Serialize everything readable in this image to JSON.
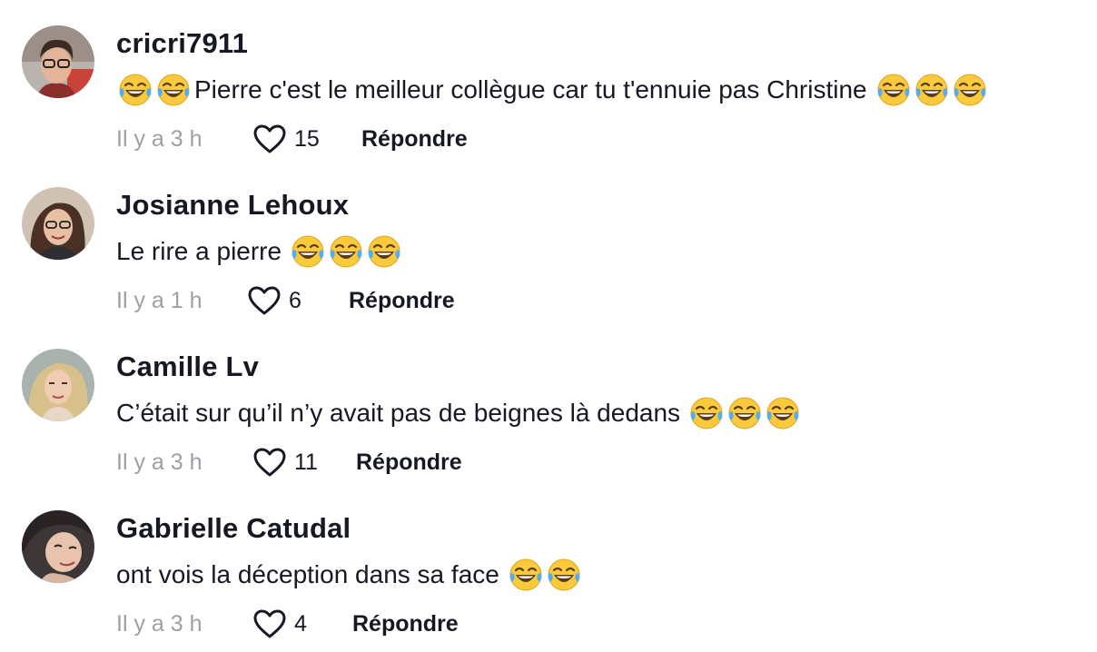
{
  "comments": [
    {
      "username": "cricri7911",
      "text": "Pierre c'est le meilleur collègue car tu t'ennuie pas Christine",
      "time": "Il y a 3 h",
      "likes": "15",
      "reply_label": "Répondre",
      "avatar_icon": "avatar-photo"
    },
    {
      "username": "Josianne Lehoux",
      "text": "Le rire a pierre",
      "time": "Il y a 1 h",
      "likes": "6",
      "reply_label": "Répondre",
      "avatar_icon": "avatar-photo"
    },
    {
      "username": "Camille Lv",
      "text": "C’était sur qu’il n’y avait pas de beignes là dedans",
      "time": "Il y a 3 h",
      "likes": "11",
      "reply_label": "Répondre",
      "avatar_icon": "avatar-photo"
    },
    {
      "username": "Gabrielle Catudal",
      "text": "ont vois la déception dans sa face",
      "time": "Il y a 3 h",
      "likes": "4",
      "reply_label": "Répondre",
      "avatar_icon": "avatar-photo"
    }
  ],
  "icons": {
    "like": "heart-outline-icon",
    "emoji": "face-with-tears-of-joy-emoji"
  },
  "colors": {
    "text_primary": "#161823",
    "text_muted": "#8a8b91",
    "emoji_yellow": "#f7c239",
    "emoji_tears": "#55acee"
  }
}
